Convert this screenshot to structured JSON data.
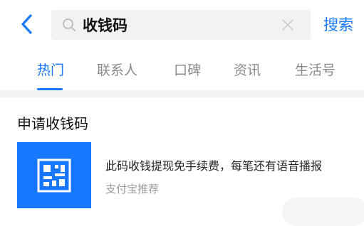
{
  "search": {
    "query": "收钱码",
    "button_label": "搜索"
  },
  "tabs": [
    {
      "label": "热门",
      "active": true
    },
    {
      "label": "联系人",
      "active": false
    },
    {
      "label": "口碑",
      "active": false
    },
    {
      "label": "资讯",
      "active": false
    },
    {
      "label": "生活号",
      "active": false
    }
  ],
  "section": {
    "title": "申请收钱码"
  },
  "result": {
    "icon": "qr-code-icon",
    "description": "此码收钱提现免手续费，每笔还有语音播报",
    "source": "支付宝推荐"
  },
  "colors": {
    "accent": "#1677ff",
    "search_bg": "#f2f2f2",
    "muted_text": "#8a8a8a"
  }
}
